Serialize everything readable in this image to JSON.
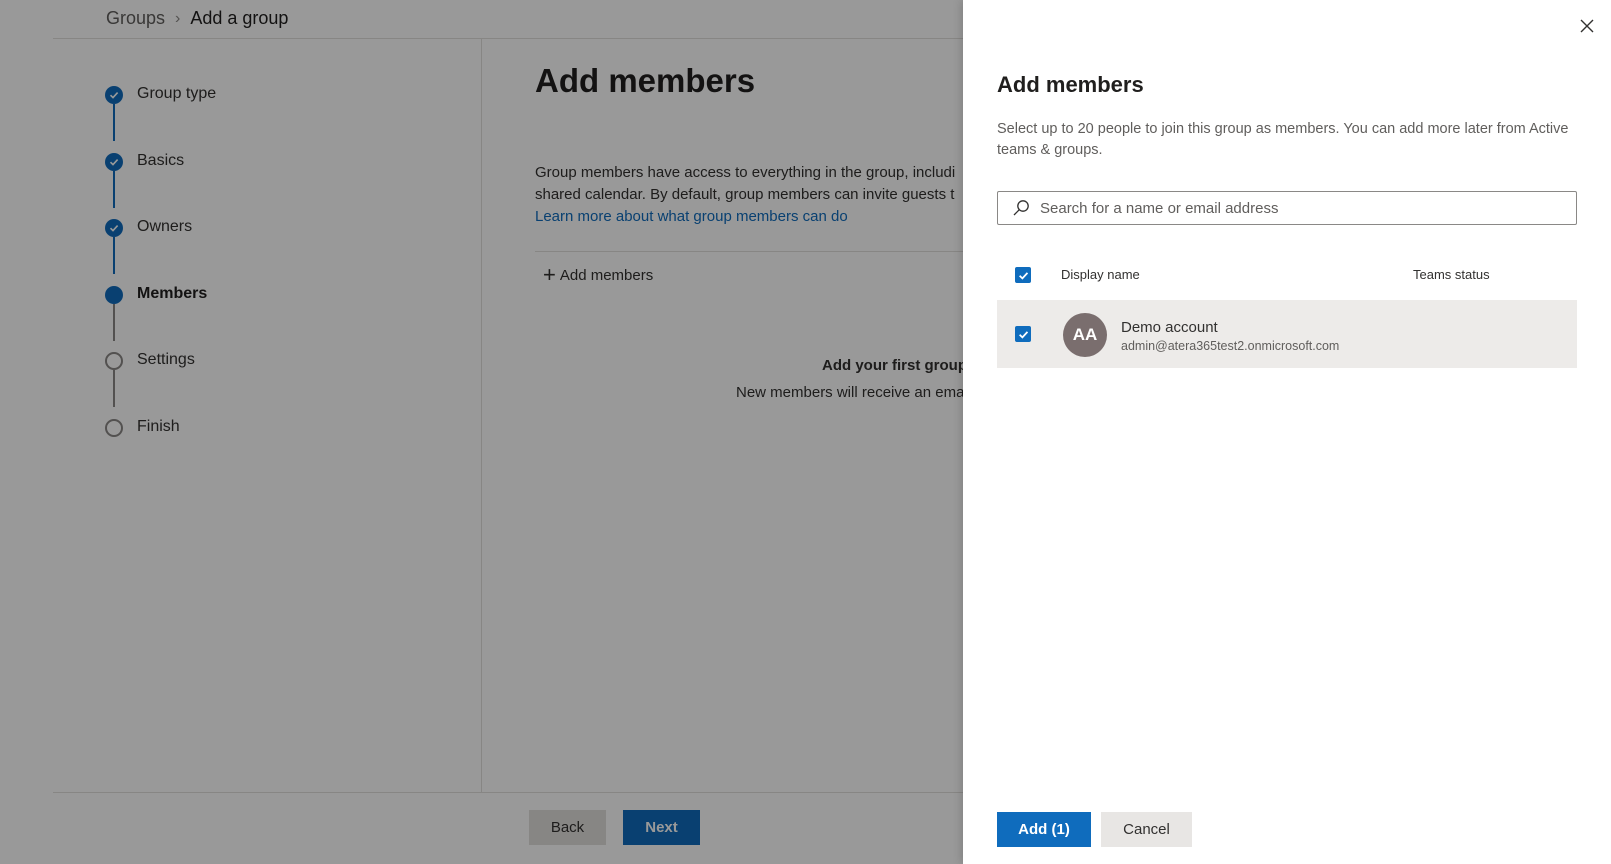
{
  "breadcrumb": {
    "parent": "Groups",
    "current": "Add a group"
  },
  "steps": [
    {
      "label": "Group type",
      "state": "done"
    },
    {
      "label": "Basics",
      "state": "done"
    },
    {
      "label": "Owners",
      "state": "done"
    },
    {
      "label": "Members",
      "state": "current"
    },
    {
      "label": "Settings",
      "state": "todo"
    },
    {
      "label": "Finish",
      "state": "todo"
    }
  ],
  "main": {
    "title": "Add members",
    "description_line1": "Group members have access to everything in the group, includi",
    "description_line2": "shared calendar. By default, group members can invite guests t",
    "learn_more": "Learn more about what group members can do",
    "add_members_cmd": "Add members",
    "empty_title": "Add your first group",
    "empty_sub": "New members will receive an ema",
    "back_label": "Back",
    "next_label": "Next"
  },
  "panel": {
    "title": "Add members",
    "description": "Select up to 20 people to join this group as members. You can add more later from Active teams & groups.",
    "search_placeholder": "Search for a name or email address",
    "columns": {
      "name": "Display name",
      "status": "Teams status"
    },
    "rows": [
      {
        "initials": "AA",
        "name": "Demo account",
        "email": "admin@atera365test2.onmicrosoft.com",
        "selected": true
      }
    ],
    "add_label": "Add (1)",
    "cancel_label": "Cancel"
  },
  "colors": {
    "accent": "#0f6cbd",
    "avatar": "#7a6e6e",
    "selected_row": "#edebe9"
  }
}
